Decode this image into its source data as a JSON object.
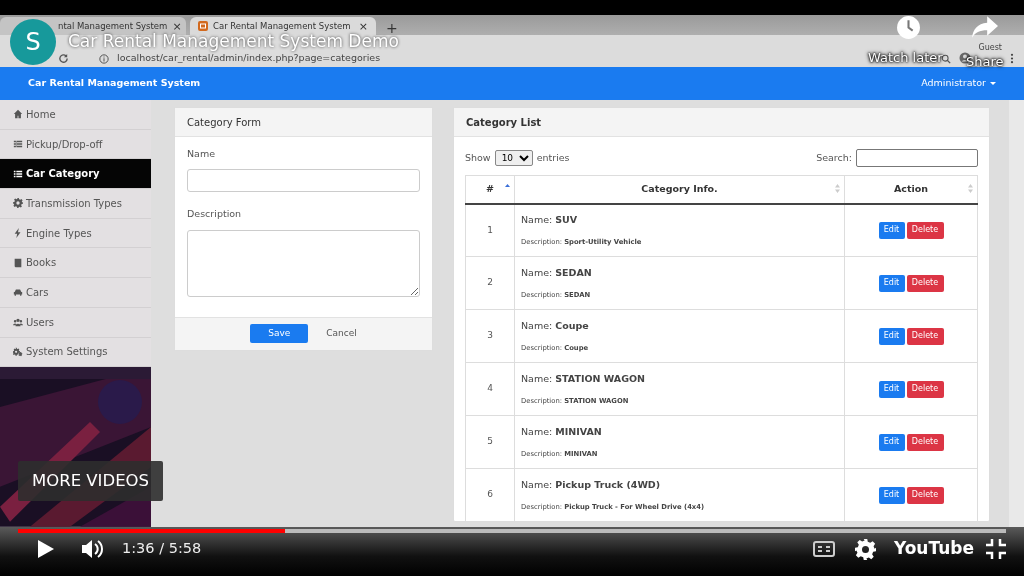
{
  "browser": {
    "tabs": [
      {
        "title": "ntal Management System",
        "close": "×",
        "selected": false
      },
      {
        "title": "Car Rental Management System",
        "close": "×",
        "selected": true
      }
    ],
    "new_tab": "+",
    "url": "localhost/car_rental/admin/index.php?page=categories",
    "profile": "Guest"
  },
  "navbar": {
    "brand": "Car Rental Management System",
    "user": "Administrator"
  },
  "sidebar": {
    "items": [
      {
        "label": "Home",
        "kind": "home",
        "selected": false
      },
      {
        "label": "Pickup/Drop-off",
        "kind": "table",
        "selected": false
      },
      {
        "label": "Car Category",
        "kind": "list",
        "selected": true
      },
      {
        "label": "Transmission Types",
        "kind": "gear",
        "selected": false
      },
      {
        "label": "Engine Types",
        "kind": "bolt",
        "selected": false
      },
      {
        "label": "Books",
        "kind": "book",
        "selected": false
      },
      {
        "label": "Cars",
        "kind": "car",
        "selected": false
      },
      {
        "label": "Users",
        "kind": "users",
        "selected": false
      },
      {
        "label": "System Settings",
        "kind": "gears",
        "selected": false
      }
    ]
  },
  "form": {
    "title": "Category Form",
    "fields": [
      {
        "label": "Name",
        "kind": "input"
      },
      {
        "label": "Description",
        "kind": "textarea"
      }
    ],
    "buttons": [
      {
        "label": "Save",
        "kind": "primary"
      },
      {
        "label": "Cancel",
        "kind": "link"
      }
    ]
  },
  "list": {
    "title": "Category List",
    "show_label": "Show",
    "page_size": "10",
    "entries_label": "entries",
    "search_label": "Search:",
    "columns": [
      {
        "label": "#",
        "selected": true
      },
      {
        "label": "Category Info.",
        "selected": false
      },
      {
        "label": "Action",
        "selected": false
      }
    ],
    "rows": [
      {
        "number": "1",
        "name": "Name: **SUV**",
        "description": "Description: **Sport-Utility Vehicle**",
        "edit": "Edit",
        "delete": "Delete"
      },
      {
        "number": "2",
        "name": "Name: **SEDAN**",
        "description": "Description: **SEDAN**",
        "edit": "Edit",
        "delete": "Delete"
      },
      {
        "number": "3",
        "name": "Name: **Coupe**",
        "description": "Description: **Coupe**",
        "edit": "Edit",
        "delete": "Delete"
      },
      {
        "number": "4",
        "name": "Name: **STATION WAGON**",
        "description": "Description: **STATION WAGON**",
        "edit": "Edit",
        "delete": "Delete"
      },
      {
        "number": "5",
        "name": "Name: **MINIVAN**",
        "description": "Description: **MINIVAN**",
        "edit": "Edit",
        "delete": "Delete"
      },
      {
        "number": "6",
        "name": "Name: **Pickup Truck (4WD)**",
        "description": "Description: **Pickup Truck - For Wheel Drive (4x4)**",
        "edit": "Edit",
        "delete": "Delete"
      }
    ]
  },
  "video": {
    "channel_initial": "S",
    "title": "Car Rental Management System Demo",
    "watch_later": "Watch later",
    "share": "Share",
    "more_videos": "MORE VIDEOS",
    "progress": {
      "level": 0.27
    },
    "time": "1:36 / 5:58",
    "logo": "YouTube"
  }
}
